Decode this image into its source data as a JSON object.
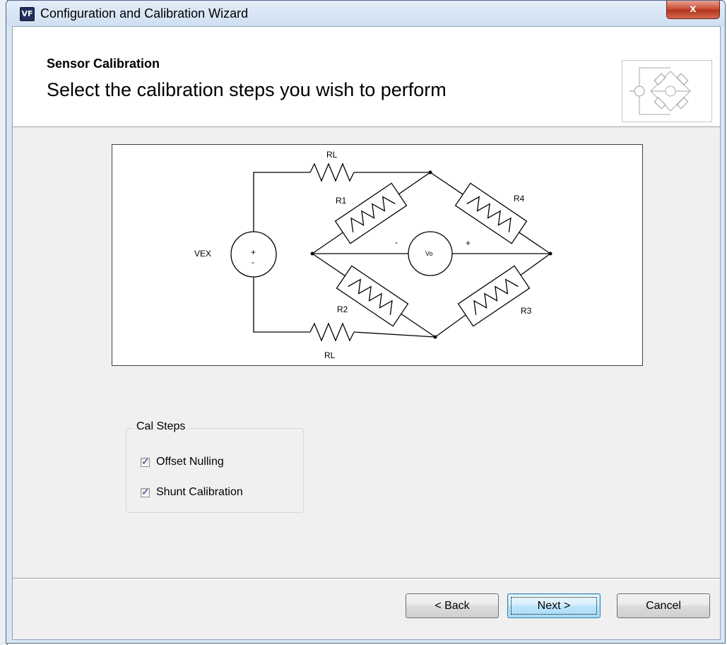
{
  "window": {
    "title": "Configuration and Calibration Wizard",
    "app_icon_text": "VF",
    "close_label": "x"
  },
  "header": {
    "step_title": "Sensor Calibration",
    "step_subtitle": "Select the calibration steps you wish to perform"
  },
  "diagram": {
    "labels": {
      "rl_top": "RL",
      "rl_bottom": "RL",
      "r1": "R1",
      "r2": "R2",
      "r3": "R3",
      "r4": "R4",
      "vex": "VEX",
      "vo": "Vo",
      "plus_source": "+",
      "minus_source": "-",
      "minus_meter": "-",
      "plus_meter": "+"
    }
  },
  "cal_steps": {
    "legend": "Cal Steps",
    "items": [
      {
        "label": "Offset Nulling",
        "checked": true
      },
      {
        "label": "Shunt Calibration",
        "checked": true
      }
    ]
  },
  "footer": {
    "back_label": "< Back",
    "next_label": "Next >",
    "cancel_label": "Cancel"
  }
}
